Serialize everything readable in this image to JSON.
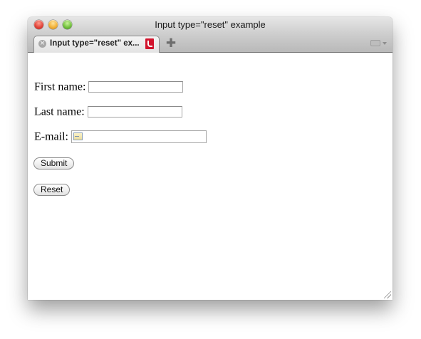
{
  "window": {
    "title": "Input type=\"reset\" example"
  },
  "tabs": [
    {
      "label": "Input type=\"reset\" ex...",
      "close_glyph": "×",
      "favicon": "opera-favicon"
    }
  ],
  "toolbar": {
    "new_tab_glyph": "✚",
    "tab_menu_icon": "tab-menu-icon"
  },
  "form": {
    "first_name": {
      "label": "First name:",
      "value": ""
    },
    "last_name": {
      "label": "Last name:",
      "value": ""
    },
    "email": {
      "label": "E-mail:",
      "value": "",
      "icon": "contact-card-icon"
    },
    "submit_label": "Submit",
    "reset_label": "Reset"
  },
  "colors": {
    "favicon_red": "#d2142d",
    "traffic_close": "#e2453b",
    "traffic_minimize": "#f2b23a",
    "traffic_maximize": "#74c23f"
  }
}
